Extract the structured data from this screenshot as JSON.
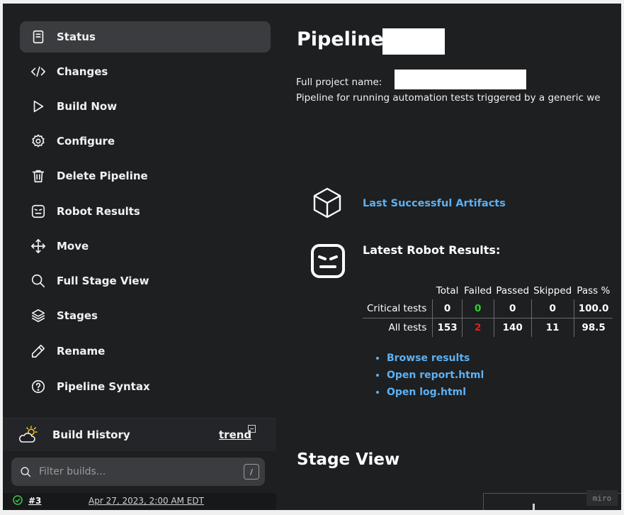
{
  "sidebar": {
    "items": [
      {
        "label": "Status",
        "icon": "document-icon",
        "active": true
      },
      {
        "label": "Changes",
        "icon": "code-icon"
      },
      {
        "label": "Build Now",
        "icon": "play-icon"
      },
      {
        "label": "Configure",
        "icon": "gear-icon"
      },
      {
        "label": "Delete Pipeline",
        "icon": "trash-icon"
      },
      {
        "label": "Robot Results",
        "icon": "robot-icon"
      },
      {
        "label": "Move",
        "icon": "move-icon"
      },
      {
        "label": "Full Stage View",
        "icon": "search-icon"
      },
      {
        "label": "Stages",
        "icon": "layers-icon"
      },
      {
        "label": "Rename",
        "icon": "pencil-icon"
      },
      {
        "label": "Pipeline Syntax",
        "icon": "help-icon"
      }
    ]
  },
  "build_history": {
    "title": "Build History",
    "trend_label": "trend",
    "filter_placeholder": "Filter builds...",
    "filter_shortcut": "/",
    "builds": [
      {
        "number": "#3",
        "date": "Apr 27, 2023, 2:00 AM EDT",
        "status": "success"
      }
    ]
  },
  "main": {
    "title": "Pipeline",
    "full_project_name_label": "Full project name:",
    "description": "Pipeline for running automation tests triggered by a generic we",
    "artifacts_link": "Last Successful Artifacts",
    "robot_title": "Latest Robot Results:",
    "robot_table": {
      "headers": [
        "Total",
        "Failed",
        "Passed",
        "Skipped",
        "Pass %"
      ],
      "rows": [
        {
          "label": "Critical tests",
          "total": "0",
          "failed": "0",
          "passed": "0",
          "skipped": "0",
          "pass_pct": "100.0"
        },
        {
          "label": "All tests",
          "total": "153",
          "failed": "2",
          "passed": "140",
          "skipped": "11",
          "pass_pct": "98.5"
        }
      ]
    },
    "links": [
      "Browse results",
      "Open report.html",
      "Open log.html"
    ],
    "stage_view_title": "Stage View",
    "watermark": "miro"
  },
  "colors": {
    "background": "#1d1f21",
    "active_item": "#3a3c3f",
    "link": "#5eb0f2",
    "failed_zero": "#22dd22",
    "failed_nonzero": "#e32020"
  }
}
